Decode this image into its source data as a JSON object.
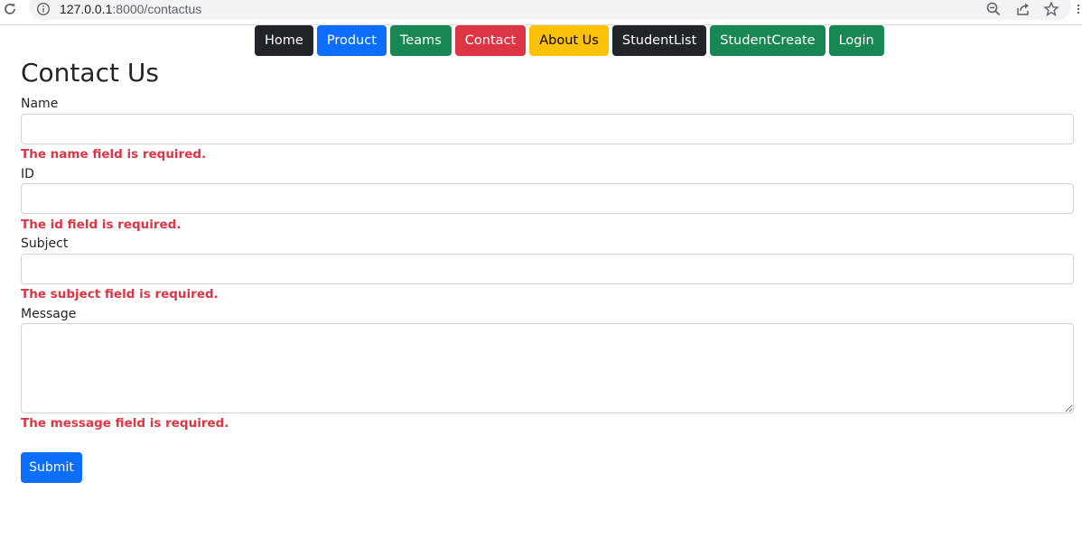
{
  "browser": {
    "url_host": "127.0.0.1",
    "url_path": ":8000/contactus",
    "icons": [
      "reload-icon",
      "info-icon",
      "zoom-icon",
      "share-icon",
      "star-icon",
      "menu-icon"
    ]
  },
  "nav": {
    "items": [
      {
        "label": "Home",
        "color": "#212529"
      },
      {
        "label": "Product",
        "color": "#0d6efd"
      },
      {
        "label": "Teams",
        "color": "#198754"
      },
      {
        "label": "Contact",
        "color": "#dc3545"
      },
      {
        "label": "About Us",
        "color": "#ffc107"
      },
      {
        "label": "StudentList",
        "color": "#212529"
      },
      {
        "label": "StudentCreate",
        "color": "#198754"
      },
      {
        "label": "Login",
        "color": "#198754"
      }
    ]
  },
  "form": {
    "title": "Contact Us",
    "fields": [
      {
        "label": "Name",
        "value": "",
        "error": "The name field is required."
      },
      {
        "label": "ID",
        "value": "",
        "error": "The id field is required."
      },
      {
        "label": "Subject",
        "value": "",
        "error": "The subject field is required."
      },
      {
        "label": "Message",
        "value": "",
        "error": "The message field is required."
      }
    ],
    "submit_label": "Submit",
    "error_color": "#dc3545"
  }
}
